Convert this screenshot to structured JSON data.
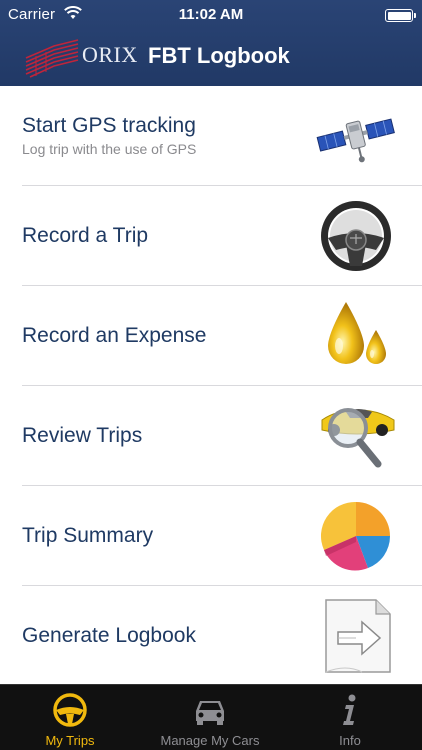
{
  "status_bar": {
    "carrier": "Carrier",
    "time": "11:02 AM"
  },
  "header": {
    "brand": "ORIX",
    "title": "FBT Logbook"
  },
  "menu": {
    "items": [
      {
        "label": "Start GPS tracking",
        "subtitle": "Log trip with the use of GPS",
        "icon": "satellite-icon"
      },
      {
        "label": "Record a Trip",
        "icon": "steering-wheel-icon"
      },
      {
        "label": "Record an Expense",
        "icon": "oil-drops-icon"
      },
      {
        "label": "Review Trips",
        "icon": "car-magnifier-icon"
      },
      {
        "label": "Trip Summary",
        "icon": "pie-chart-icon"
      },
      {
        "label": "Generate Logbook",
        "icon": "document-arrow-icon"
      }
    ]
  },
  "tab_bar": {
    "tabs": [
      {
        "label": "My Trips",
        "icon": "steering-wheel-icon",
        "active": true
      },
      {
        "label": "Manage My Cars",
        "icon": "car-icon",
        "active": false
      },
      {
        "label": "Info",
        "icon": "info-icon",
        "active": false
      }
    ]
  },
  "colors": {
    "header_bg": "#243d6b",
    "item_text": "#1f3a63",
    "active_tab": "#f1b90e",
    "inactive_tab": "#8e8e93",
    "tab_bar_bg": "#111111"
  }
}
